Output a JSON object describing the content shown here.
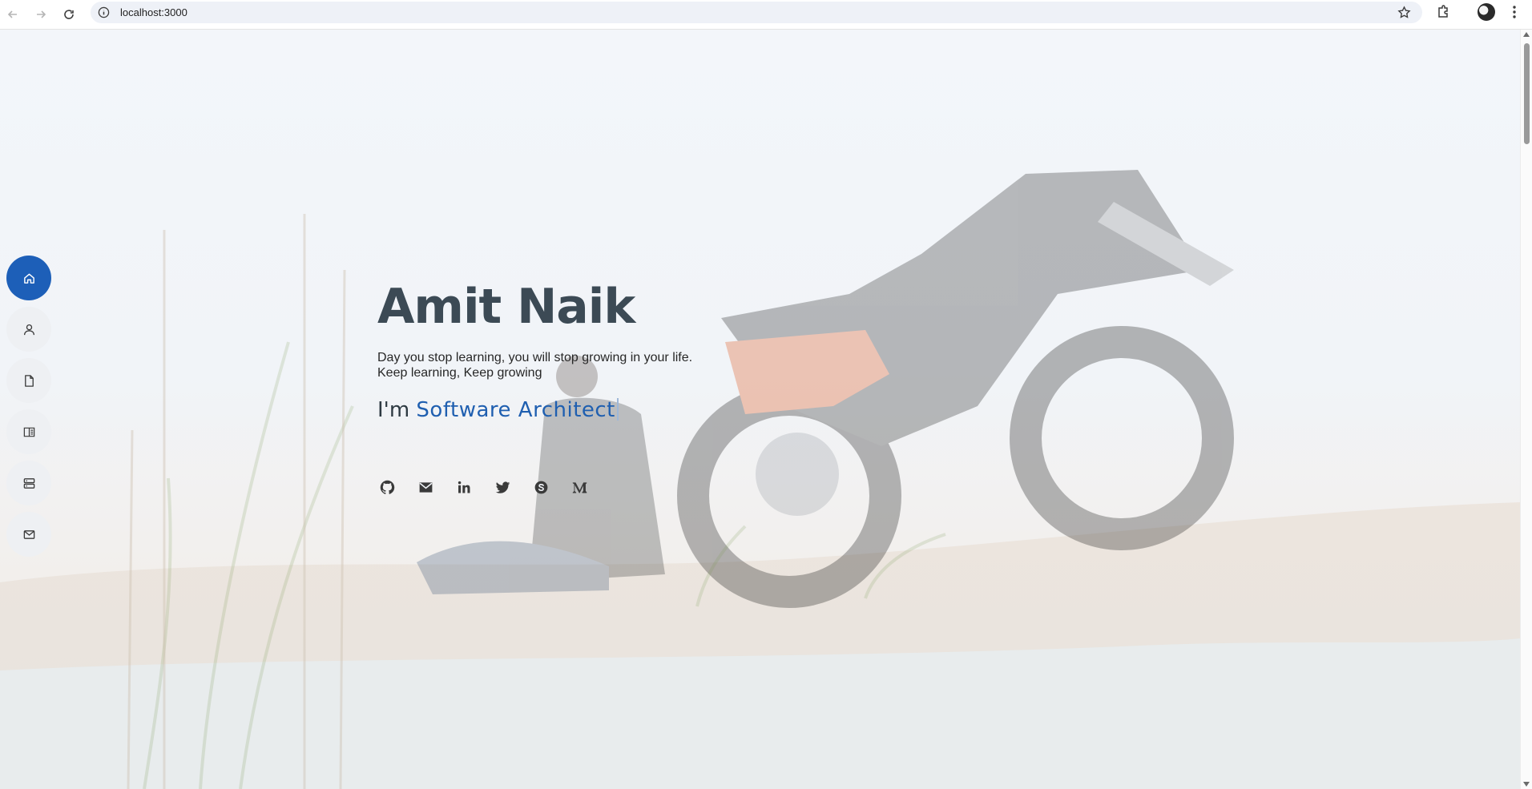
{
  "browser": {
    "url": "localhost:3000"
  },
  "side_nav": {
    "items": [
      {
        "id": "home",
        "icon": "home-icon",
        "active": true
      },
      {
        "id": "about",
        "icon": "user-icon",
        "active": false
      },
      {
        "id": "resume",
        "icon": "document-icon",
        "active": false
      },
      {
        "id": "portfolio",
        "icon": "book-icon",
        "active": false
      },
      {
        "id": "services",
        "icon": "server-icon",
        "active": false
      },
      {
        "id": "contact",
        "icon": "envelope-icon",
        "active": false
      }
    ]
  },
  "hero": {
    "name": "Amit Naik",
    "quote_line1": "Day you stop learning, you will stop growing in your life.",
    "quote_line2": "Keep learning, Keep growing",
    "role_prefix": "I'm ",
    "role": "Software Architect"
  },
  "socials": [
    {
      "id": "github",
      "icon": "github-icon"
    },
    {
      "id": "email",
      "icon": "envelope-icon"
    },
    {
      "id": "linkedin",
      "icon": "linkedin-icon"
    },
    {
      "id": "twitter",
      "icon": "twitter-icon"
    },
    {
      "id": "skype",
      "icon": "skype-icon"
    },
    {
      "id": "medium",
      "icon": "medium-icon"
    }
  ],
  "colors": {
    "accent": "#1d5fb8",
    "title": "#3c4a55",
    "nav_bg": "#eef0f3"
  }
}
